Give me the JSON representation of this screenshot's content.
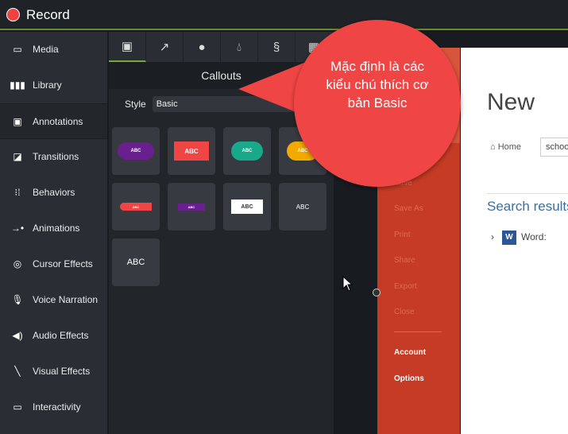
{
  "topbar": {
    "record_label": "Record"
  },
  "sidebar": {
    "items": [
      {
        "label": "Media",
        "icon": "film-icon"
      },
      {
        "label": "Library",
        "icon": "library-icon"
      },
      {
        "label": "Annotations",
        "icon": "annotation-icon",
        "active": true
      },
      {
        "label": "Transitions",
        "icon": "transition-icon"
      },
      {
        "label": "Behaviors",
        "icon": "behaviors-icon"
      },
      {
        "label": "Animations",
        "icon": "animation-icon"
      },
      {
        "label": "Cursor Effects",
        "icon": "cursor-effects-icon"
      },
      {
        "label": "Voice Narration",
        "icon": "microphone-icon"
      },
      {
        "label": "Audio Effects",
        "icon": "speaker-icon"
      },
      {
        "label": "Visual Effects",
        "icon": "magic-wand-icon"
      },
      {
        "label": "Interactivity",
        "icon": "interactivity-icon"
      }
    ]
  },
  "panel": {
    "tabs": [
      "callouts-icon",
      "arrow-icon",
      "shape-icon",
      "blur-icon",
      "sketch-motion-icon",
      "keystroke-icon"
    ],
    "title": "Callouts",
    "style_label": "Style",
    "style_value": "Basic",
    "tiles": [
      "ABC",
      "ABC",
      "ABC",
      "ABC",
      "ABC",
      "ABC",
      "ABC",
      "ABC",
      "ABC"
    ]
  },
  "callout_bubble": {
    "text": "Mặc định là các kiểu chú thích cơ bản Basic",
    "color": "#f04545"
  },
  "ppt": {
    "menu": [
      "Save",
      "Save As",
      "Print",
      "Share",
      "Export",
      "Close"
    ],
    "menu_bold": [
      "Account",
      "Options"
    ],
    "title": "New",
    "home": "Home",
    "search_value": "school",
    "search_results": "Search results",
    "word_label": "Word:"
  },
  "colors": {
    "accent": "#7ea33a",
    "record": "#f24141",
    "ppt_red": "#c63b25"
  }
}
